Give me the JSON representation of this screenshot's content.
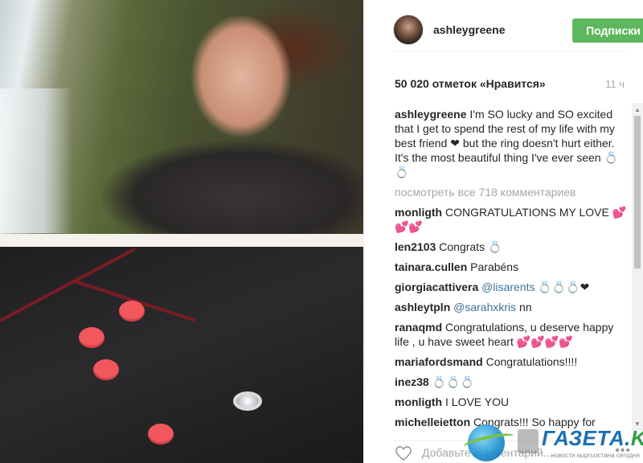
{
  "post": {
    "username": "ashleygreene",
    "follow_label": "Подписки",
    "likes": "50 020 отметок «Нравится»",
    "time": "11 ч",
    "caption_user": "ashleygreene",
    "caption_text": "I'm SO lucky and SO excited that I get to spend the rest of my life with my best friend ❤ but the ring doesn't hurt either. It's the most beautiful thing I've ever seen 💍💍",
    "view_all": "посмотреть все 718 комментариев"
  },
  "comments": [
    {
      "user": "monligth",
      "text": "CONGRATULATIONS MY LOVE 💕💕💕"
    },
    {
      "user": "len2103",
      "text": "Congrats 💍"
    },
    {
      "user": "tainara.cullen",
      "text": "Parabéns"
    },
    {
      "user": "giorgiacattivera",
      "mention": "@lisarents",
      "text": " 💍💍💍❤"
    },
    {
      "user": "ashleytpln",
      "mention": "@sarahxkris",
      "text": " nn"
    },
    {
      "user": "ranaqmd",
      "text": "Congratulations, u deserve happy life , u have sweet heart 💕💕💕💕"
    },
    {
      "user": "mariafordsmand",
      "text": "Congratulations!!!!"
    },
    {
      "user": "inez38",
      "text": "💍💍💍"
    },
    {
      "user": "monligth",
      "text": "I LOVE YOU"
    },
    {
      "user": "michelleietton",
      "text": "Congrats!!! So happy for"
    }
  ],
  "footer": {
    "placeholder": "Добавьте комментарий...",
    "more": "•••"
  },
  "watermark": {
    "text_main": "ГАЗЕТА.",
    "text_kg": "KG",
    "tagline": "новости кыргызстана сегодня"
  },
  "icons": {
    "heart": "heart-outline-icon",
    "avatar": "profile-avatar"
  },
  "colors": {
    "follow_button": "#5cb85c",
    "mention": "#3f729b",
    "muted": "#a5a7aa"
  }
}
